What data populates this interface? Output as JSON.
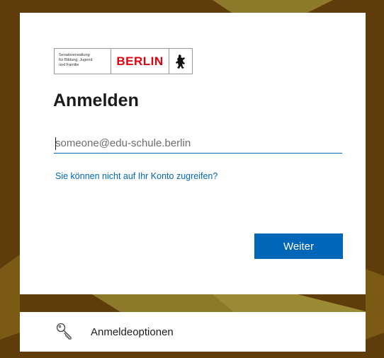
{
  "logo": {
    "department_lines": [
      "Senatsverwaltung",
      "für Bildung, Jugend",
      "und Familie"
    ],
    "city": "BERLIN",
    "emblem": "berlin-bear-icon"
  },
  "signin": {
    "title": "Anmelden",
    "email_placeholder": "someone@edu-schule.berlin",
    "email_value": "",
    "help_link": "Sie können nicht auf Ihr Konto zugreifen?",
    "next_label": "Weiter"
  },
  "options": {
    "icon": "key-icon",
    "label": "Anmeldeoptionen"
  },
  "colors": {
    "accent": "#0067b8",
    "berlin_red": "#e3000f",
    "background_brown": "#5e3d0a",
    "background_olive": "#8c7a2a"
  }
}
